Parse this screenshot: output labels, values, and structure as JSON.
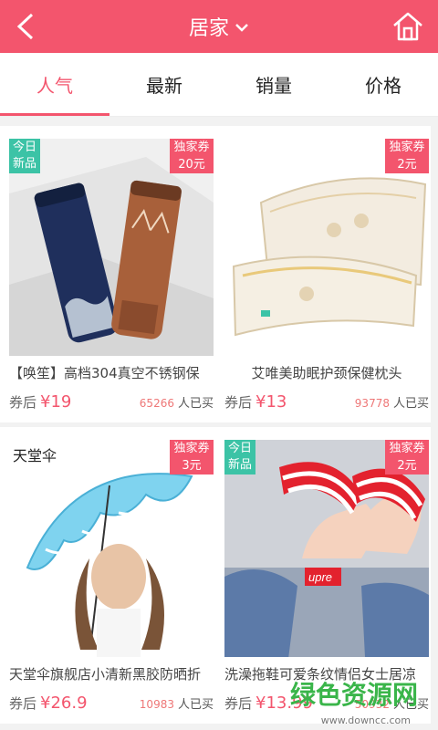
{
  "header": {
    "title": "居家",
    "back_icon": "chevron-left-icon",
    "dropdown_icon": "chevron-down-icon",
    "home_icon": "home-icon",
    "bg_color": "#f3556d"
  },
  "tabs": [
    {
      "label": "人气",
      "active": true
    },
    {
      "label": "最新",
      "active": false
    },
    {
      "label": "销量",
      "active": false
    },
    {
      "label": "价格",
      "active": false
    }
  ],
  "products": [
    {
      "name": "【唤笙】高档304真空不锈钢保",
      "coupon_prefix": "券后",
      "price": "¥19",
      "sold_count": "65266",
      "sold_label": "人已买",
      "badge_new": [
        "今日",
        "新品"
      ],
      "coupon_badge": [
        "独家券",
        "20元"
      ]
    },
    {
      "name": "艾唯美助眠护颈保健枕头",
      "coupon_prefix": "券后",
      "price": "¥13",
      "sold_count": "93778",
      "sold_label": "人已买",
      "coupon_badge": [
        "独家券",
        "2元"
      ]
    },
    {
      "name": "天堂伞旗舰店小清新黑胶防晒折",
      "coupon_prefix": "券后",
      "price": "¥26.9",
      "sold_count": "10983",
      "sold_label": "人已买",
      "brand_mark": "天堂伞",
      "coupon_badge": [
        "独家券",
        "3元"
      ]
    },
    {
      "name": "洗澡拖鞋可爱条纹情侣女士居凉",
      "coupon_prefix": "券后",
      "price": "¥13.99",
      "sold_count": "50932",
      "sold_label": "人已买",
      "badge_new": [
        "今日",
        "新品"
      ],
      "coupon_badge": [
        "独家券",
        "2元"
      ],
      "image_text": "upre"
    }
  ],
  "watermark": {
    "text": "绿色资源网",
    "url": "www.downcc.com"
  }
}
